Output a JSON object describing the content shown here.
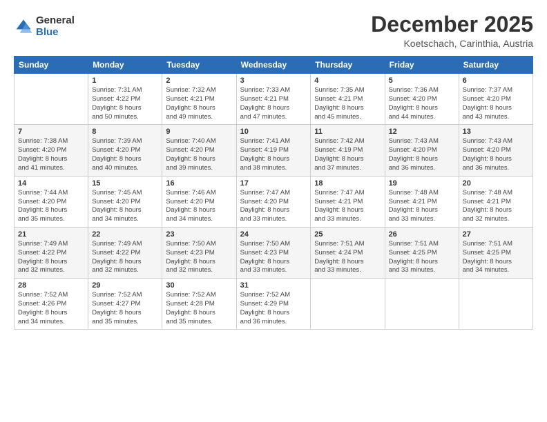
{
  "logo": {
    "general": "General",
    "blue": "Blue"
  },
  "header": {
    "month": "December 2025",
    "location": "Koetschach, Carinthia, Austria"
  },
  "weekdays": [
    "Sunday",
    "Monday",
    "Tuesday",
    "Wednesday",
    "Thursday",
    "Friday",
    "Saturday"
  ],
  "weeks": [
    [
      {
        "day": "",
        "info": ""
      },
      {
        "day": "1",
        "info": "Sunrise: 7:31 AM\nSunset: 4:22 PM\nDaylight: 8 hours\nand 50 minutes."
      },
      {
        "day": "2",
        "info": "Sunrise: 7:32 AM\nSunset: 4:21 PM\nDaylight: 8 hours\nand 49 minutes."
      },
      {
        "day": "3",
        "info": "Sunrise: 7:33 AM\nSunset: 4:21 PM\nDaylight: 8 hours\nand 47 minutes."
      },
      {
        "day": "4",
        "info": "Sunrise: 7:35 AM\nSunset: 4:21 PM\nDaylight: 8 hours\nand 45 minutes."
      },
      {
        "day": "5",
        "info": "Sunrise: 7:36 AM\nSunset: 4:20 PM\nDaylight: 8 hours\nand 44 minutes."
      },
      {
        "day": "6",
        "info": "Sunrise: 7:37 AM\nSunset: 4:20 PM\nDaylight: 8 hours\nand 43 minutes."
      }
    ],
    [
      {
        "day": "7",
        "info": "Sunrise: 7:38 AM\nSunset: 4:20 PM\nDaylight: 8 hours\nand 41 minutes."
      },
      {
        "day": "8",
        "info": "Sunrise: 7:39 AM\nSunset: 4:20 PM\nDaylight: 8 hours\nand 40 minutes."
      },
      {
        "day": "9",
        "info": "Sunrise: 7:40 AM\nSunset: 4:20 PM\nDaylight: 8 hours\nand 39 minutes."
      },
      {
        "day": "10",
        "info": "Sunrise: 7:41 AM\nSunset: 4:19 PM\nDaylight: 8 hours\nand 38 minutes."
      },
      {
        "day": "11",
        "info": "Sunrise: 7:42 AM\nSunset: 4:19 PM\nDaylight: 8 hours\nand 37 minutes."
      },
      {
        "day": "12",
        "info": "Sunrise: 7:43 AM\nSunset: 4:20 PM\nDaylight: 8 hours\nand 36 minutes."
      },
      {
        "day": "13",
        "info": "Sunrise: 7:43 AM\nSunset: 4:20 PM\nDaylight: 8 hours\nand 36 minutes."
      }
    ],
    [
      {
        "day": "14",
        "info": "Sunrise: 7:44 AM\nSunset: 4:20 PM\nDaylight: 8 hours\nand 35 minutes."
      },
      {
        "day": "15",
        "info": "Sunrise: 7:45 AM\nSunset: 4:20 PM\nDaylight: 8 hours\nand 34 minutes."
      },
      {
        "day": "16",
        "info": "Sunrise: 7:46 AM\nSunset: 4:20 PM\nDaylight: 8 hours\nand 34 minutes."
      },
      {
        "day": "17",
        "info": "Sunrise: 7:47 AM\nSunset: 4:20 PM\nDaylight: 8 hours\nand 33 minutes."
      },
      {
        "day": "18",
        "info": "Sunrise: 7:47 AM\nSunset: 4:21 PM\nDaylight: 8 hours\nand 33 minutes."
      },
      {
        "day": "19",
        "info": "Sunrise: 7:48 AM\nSunset: 4:21 PM\nDaylight: 8 hours\nand 33 minutes."
      },
      {
        "day": "20",
        "info": "Sunrise: 7:48 AM\nSunset: 4:21 PM\nDaylight: 8 hours\nand 32 minutes."
      }
    ],
    [
      {
        "day": "21",
        "info": "Sunrise: 7:49 AM\nSunset: 4:22 PM\nDaylight: 8 hours\nand 32 minutes."
      },
      {
        "day": "22",
        "info": "Sunrise: 7:49 AM\nSunset: 4:22 PM\nDaylight: 8 hours\nand 32 minutes."
      },
      {
        "day": "23",
        "info": "Sunrise: 7:50 AM\nSunset: 4:23 PM\nDaylight: 8 hours\nand 32 minutes."
      },
      {
        "day": "24",
        "info": "Sunrise: 7:50 AM\nSunset: 4:23 PM\nDaylight: 8 hours\nand 33 minutes."
      },
      {
        "day": "25",
        "info": "Sunrise: 7:51 AM\nSunset: 4:24 PM\nDaylight: 8 hours\nand 33 minutes."
      },
      {
        "day": "26",
        "info": "Sunrise: 7:51 AM\nSunset: 4:25 PM\nDaylight: 8 hours\nand 33 minutes."
      },
      {
        "day": "27",
        "info": "Sunrise: 7:51 AM\nSunset: 4:25 PM\nDaylight: 8 hours\nand 34 minutes."
      }
    ],
    [
      {
        "day": "28",
        "info": "Sunrise: 7:52 AM\nSunset: 4:26 PM\nDaylight: 8 hours\nand 34 minutes."
      },
      {
        "day": "29",
        "info": "Sunrise: 7:52 AM\nSunset: 4:27 PM\nDaylight: 8 hours\nand 35 minutes."
      },
      {
        "day": "30",
        "info": "Sunrise: 7:52 AM\nSunset: 4:28 PM\nDaylight: 8 hours\nand 35 minutes."
      },
      {
        "day": "31",
        "info": "Sunrise: 7:52 AM\nSunset: 4:29 PM\nDaylight: 8 hours\nand 36 minutes."
      },
      {
        "day": "",
        "info": ""
      },
      {
        "day": "",
        "info": ""
      },
      {
        "day": "",
        "info": ""
      }
    ]
  ]
}
